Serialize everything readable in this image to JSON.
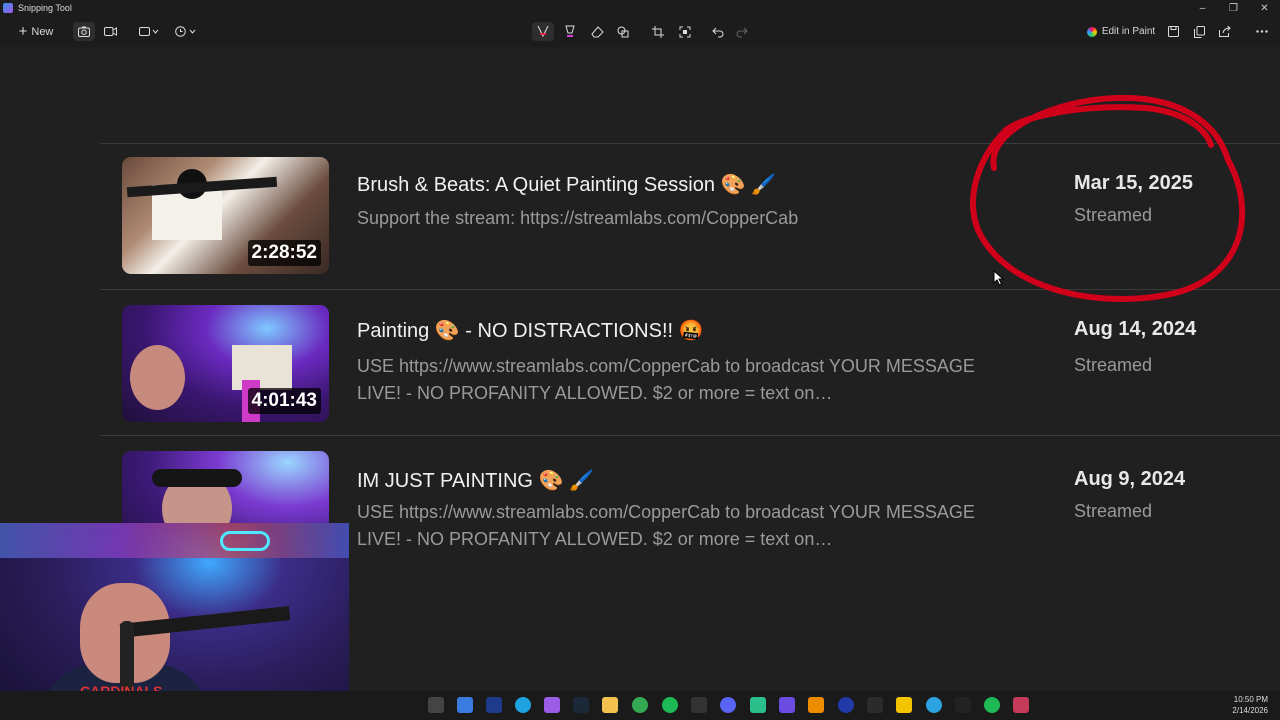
{
  "app": {
    "title": "Snipping Tool"
  },
  "toolbar": {
    "new_label": "New",
    "edit_in_paint_label": "Edit in Paint"
  },
  "videos": [
    {
      "title": "Brush & Beats: A Quiet Painting Session 🎨 🖌️",
      "description": "Support the stream: https://streamlabs.com/CopperCab",
      "duration": "2:28:52",
      "date": "Mar 15, 2025",
      "status": "Streamed"
    },
    {
      "title": "Painting 🎨 - NO DISTRACTIONS!! 🤬",
      "description": "USE https://www.streamlabs.com/CopperCab to broadcast YOUR MESSAGE LIVE! - NO PROFANITY ALLOWED. $2 or more = text on…",
      "duration": "4:01:43",
      "date": "Aug 14, 2024",
      "status": "Streamed"
    },
    {
      "title": "IM JUST PAINTING 🎨 🖌️",
      "description": "USE https://www.streamlabs.com/CopperCab to broadcast YOUR MESSAGE LIVE! - NO PROFANITY ALLOWED. $2 or more = text on…",
      "duration": "",
      "date": "Aug 9, 2024",
      "status": "Streamed"
    }
  ],
  "webcam": {
    "shirt_text": "CARDINALS"
  },
  "taskbar": {
    "time": "10:50 PM",
    "date": "2/14/2026"
  },
  "colors": {
    "annotation": "#d0001a",
    "background": "#202020"
  }
}
